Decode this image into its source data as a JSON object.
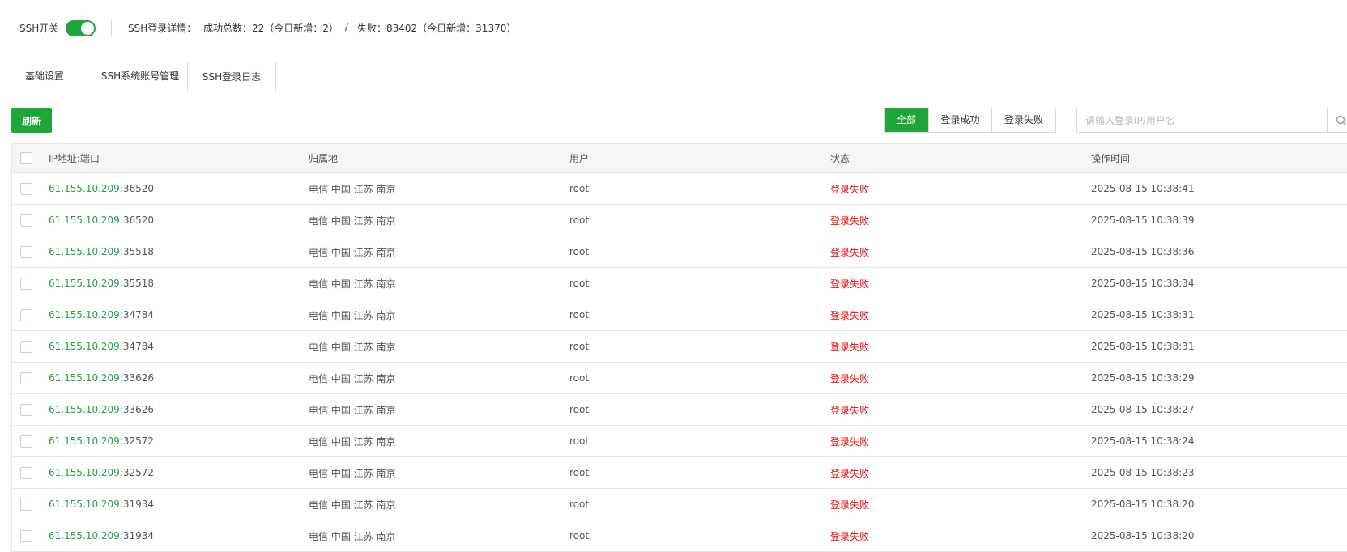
{
  "topbar": {
    "ssh_label": "SSH开关",
    "ssh_enabled": true,
    "detail_label": "SSH登录详情：",
    "success_text": "成功总数：22（今日新增：2）",
    "separator": "/",
    "fail_text": "失败：83402（今日新增：31370）"
  },
  "tabs": [
    {
      "label": "基础设置",
      "active": false
    },
    {
      "label": "SSH系统账号管理",
      "active": false
    },
    {
      "label": "SSH登录日志",
      "active": true
    }
  ],
  "toolbar": {
    "refresh_label": "刷新",
    "filters": [
      {
        "label": "全部",
        "active": true
      },
      {
        "label": "登录成功",
        "active": false
      },
      {
        "label": "登录失败",
        "active": false
      }
    ],
    "search_placeholder": "请输入登录IP/用户名",
    "search_value": ""
  },
  "table": {
    "columns": [
      "IP地址:端口",
      "归属地",
      "用户",
      "状态",
      "操作时间"
    ],
    "rows": [
      {
        "ip": "61.155.10.209",
        "port": ":36520",
        "location": "电信 中国 江苏 南京",
        "user": "root",
        "status": "登录失败",
        "time": "2025-08-15 10:38:41"
      },
      {
        "ip": "61.155.10.209",
        "port": ":36520",
        "location": "电信 中国 江苏 南京",
        "user": "root",
        "status": "登录失败",
        "time": "2025-08-15 10:38:39"
      },
      {
        "ip": "61.155.10.209",
        "port": ":35518",
        "location": "电信 中国 江苏 南京",
        "user": "root",
        "status": "登录失败",
        "time": "2025-08-15 10:38:36"
      },
      {
        "ip": "61.155.10.209",
        "port": ":35518",
        "location": "电信 中国 江苏 南京",
        "user": "root",
        "status": "登录失败",
        "time": "2025-08-15 10:38:34"
      },
      {
        "ip": "61.155.10.209",
        "port": ":34784",
        "location": "电信 中国 江苏 南京",
        "user": "root",
        "status": "登录失败",
        "time": "2025-08-15 10:38:31"
      },
      {
        "ip": "61.155.10.209",
        "port": ":34784",
        "location": "电信 中国 江苏 南京",
        "user": "root",
        "status": "登录失败",
        "time": "2025-08-15 10:38:31"
      },
      {
        "ip": "61.155.10.209",
        "port": ":33626",
        "location": "电信 中国 江苏 南京",
        "user": "root",
        "status": "登录失败",
        "time": "2025-08-15 10:38:29"
      },
      {
        "ip": "61.155.10.209",
        "port": ":33626",
        "location": "电信 中国 江苏 南京",
        "user": "root",
        "status": "登录失败",
        "time": "2025-08-15 10:38:27"
      },
      {
        "ip": "61.155.10.209",
        "port": ":32572",
        "location": "电信 中国 江苏 南京",
        "user": "root",
        "status": "登录失败",
        "time": "2025-08-15 10:38:24"
      },
      {
        "ip": "61.155.10.209",
        "port": ":32572",
        "location": "电信 中国 江苏 南京",
        "user": "root",
        "status": "登录失败",
        "time": "2025-08-15 10:38:23"
      },
      {
        "ip": "61.155.10.209",
        "port": ":31934",
        "location": "电信 中国 江苏 南京",
        "user": "root",
        "status": "登录失败",
        "time": "2025-08-15 10:38:20"
      },
      {
        "ip": "61.155.10.209",
        "port": ":31934",
        "location": "电信 中国 江苏 南京",
        "user": "root",
        "status": "登录失败",
        "time": "2025-08-15 10:38:20"
      }
    ]
  },
  "colors": {
    "accent": "#20a53a",
    "fail": "#ef0808"
  },
  "icons": {
    "search": "search-icon",
    "toggle": "toggle-switch"
  }
}
